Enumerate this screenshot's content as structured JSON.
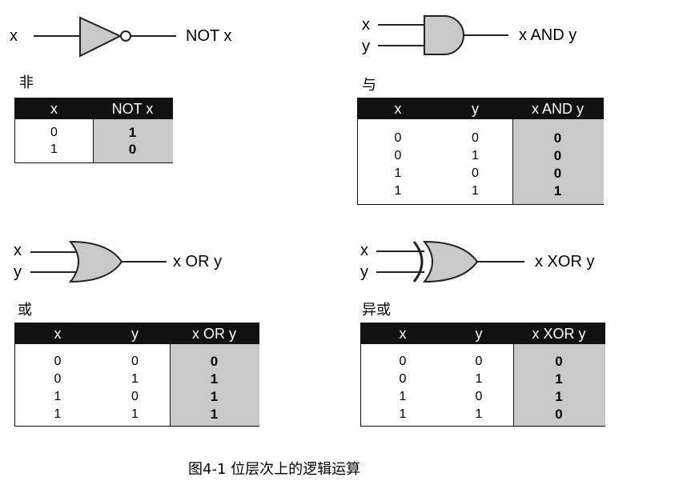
{
  "not_block": {
    "in_x": "x",
    "out": "NOT x",
    "title": "非",
    "headers": [
      "x",
      "NOT x"
    ],
    "rows": [
      [
        "0",
        "1"
      ],
      [
        "1",
        "0"
      ]
    ]
  },
  "and_block": {
    "in_x": "x",
    "in_y": "y",
    "out": "x AND y",
    "title": "与",
    "headers": [
      "x",
      "y",
      "x AND y"
    ],
    "rows": [
      [
        "0",
        "0",
        "0"
      ],
      [
        "0",
        "1",
        "0"
      ],
      [
        "1",
        "0",
        "0"
      ],
      [
        "1",
        "1",
        "1"
      ]
    ]
  },
  "or_block": {
    "in_x": "x",
    "in_y": "y",
    "out": "x OR y",
    "title": "或",
    "headers": [
      "x",
      "y",
      "x OR y"
    ],
    "rows": [
      [
        "0",
        "0",
        "0"
      ],
      [
        "0",
        "1",
        "1"
      ],
      [
        "1",
        "0",
        "1"
      ],
      [
        "1",
        "1",
        "1"
      ]
    ]
  },
  "xor_block": {
    "in_x": "x",
    "in_y": "y",
    "out": "x XOR y",
    "title": "异或",
    "headers": [
      "x",
      "y",
      "x XOR y"
    ],
    "rows": [
      [
        "0",
        "0",
        "0"
      ],
      [
        "0",
        "1",
        "1"
      ],
      [
        "1",
        "0",
        "1"
      ],
      [
        "1",
        "1",
        "0"
      ]
    ]
  },
  "caption": "图4-1    位层次上的逻辑运算",
  "colors": {
    "gate_fill": "#c9c9c9",
    "header_bg": "#111111",
    "shade": "#c9c9c9"
  }
}
